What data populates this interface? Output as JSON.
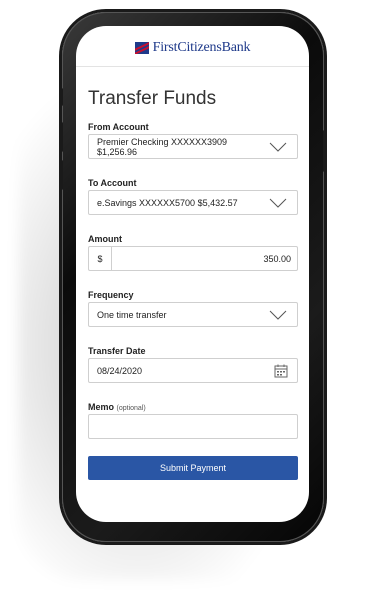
{
  "brand": {
    "name": "FirstCitizensBank",
    "color": "#1f3a8a",
    "accent": "#c8102e"
  },
  "page": {
    "title": "Transfer Funds"
  },
  "form": {
    "from_account": {
      "label": "From Account",
      "value": "Premier Checking XXXXXX3909 $1,256.96"
    },
    "to_account": {
      "label": "To Account",
      "value": "e.Savings XXXXXX5700 $5,432.57"
    },
    "amount": {
      "label": "Amount",
      "currency": "$",
      "value": "350.00"
    },
    "frequency": {
      "label": "Frequency",
      "value": "One time transfer"
    },
    "transfer_date": {
      "label": "Transfer Date",
      "value": "08/24/2020"
    },
    "memo": {
      "label": "Memo",
      "optional": "(optional)",
      "value": ""
    },
    "submit_label": "Submit Payment",
    "submit_color": "#2a56a5"
  },
  "icons": {
    "dropdown": "chevron-down-icon",
    "calendar": "calendar-icon",
    "logo": "flag-logo-icon"
  }
}
